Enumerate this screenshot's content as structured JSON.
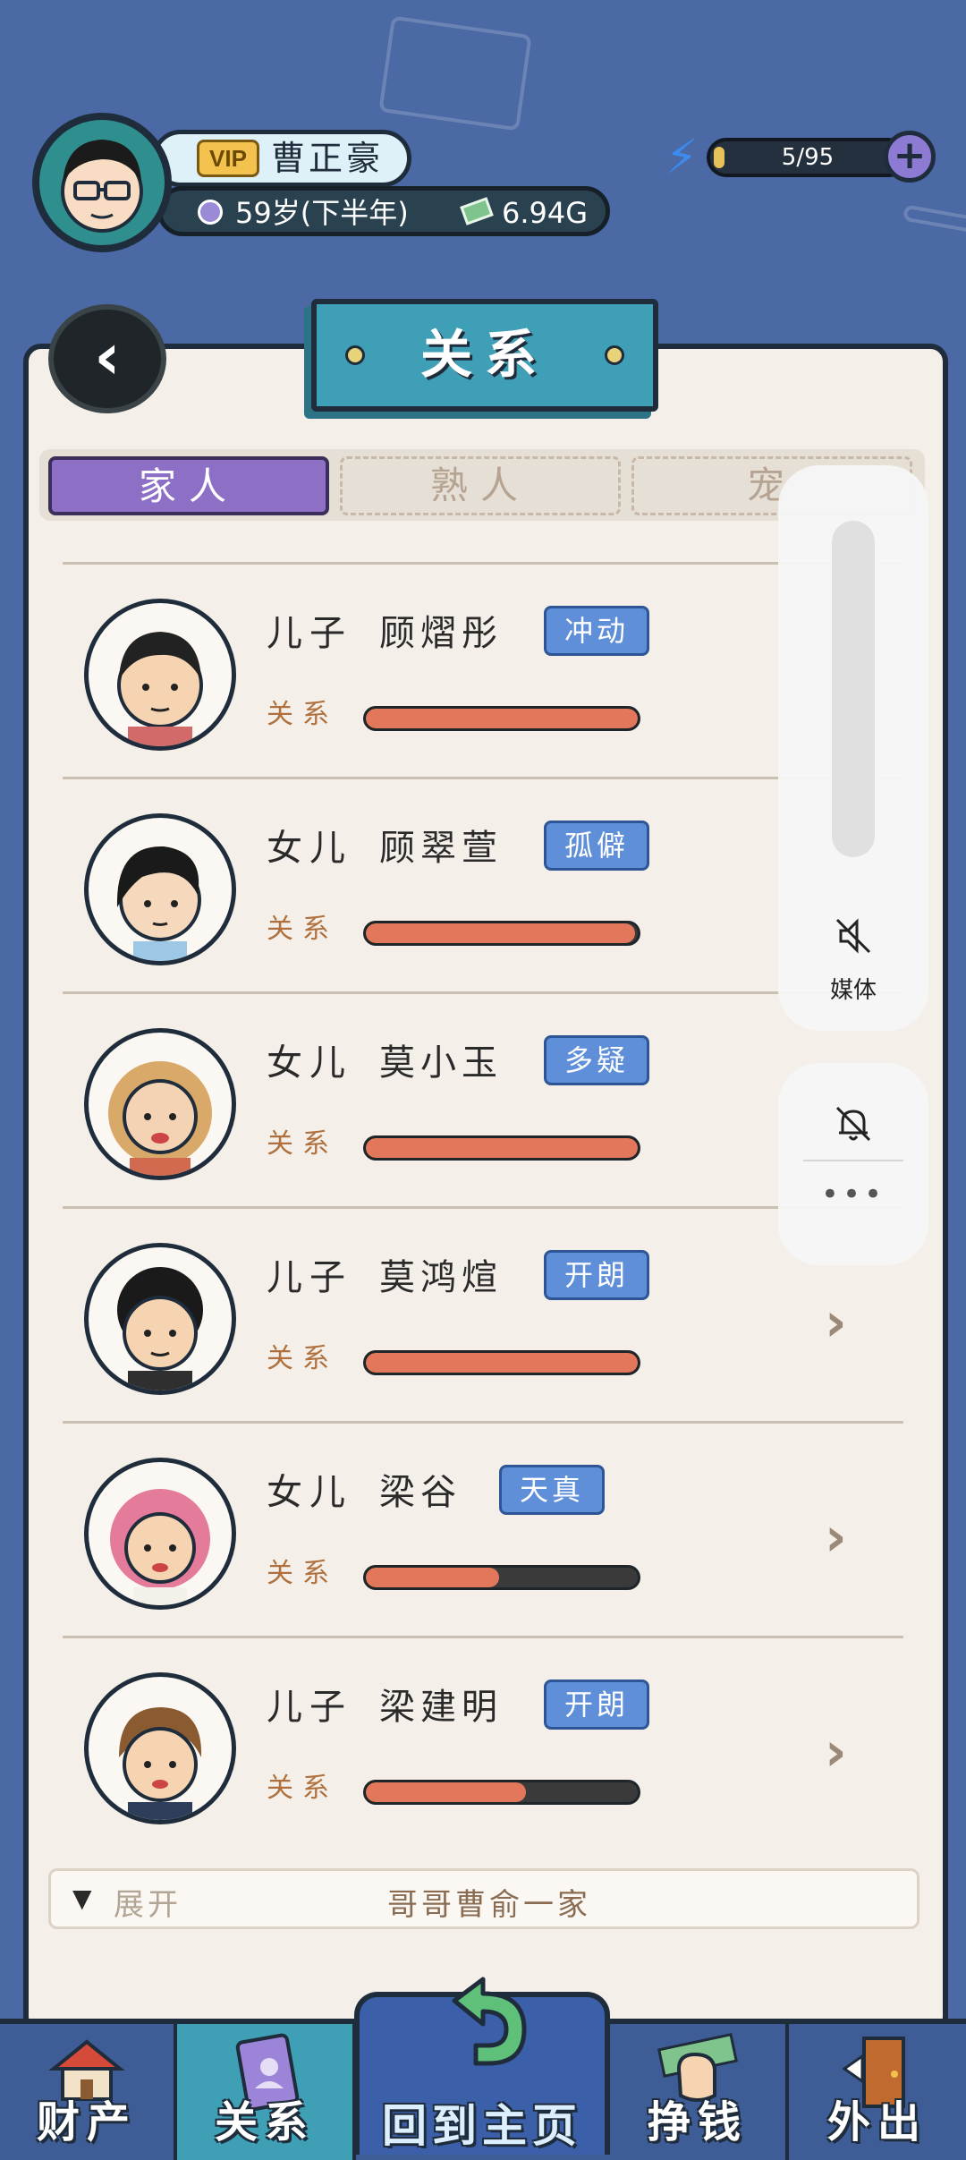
{
  "player": {
    "vip_label": "VIP",
    "name": "曹正豪",
    "age": "59岁(下半年)",
    "money": "6.94G"
  },
  "energy": {
    "current": 5,
    "max": 95,
    "text": "5/95"
  },
  "header": {
    "title": "关系"
  },
  "tabs": [
    {
      "label": "家人",
      "active": true
    },
    {
      "label": "熟人",
      "active": false
    },
    {
      "label": "宠",
      "active": false
    }
  ],
  "relations": [
    {
      "role": "儿子",
      "name": "顾熠彤",
      "trait": "冲动",
      "relation_label": "关系",
      "relation_value": 1.0
    },
    {
      "role": "女儿",
      "name": "顾翠萱",
      "trait": "孤僻",
      "relation_label": "关系",
      "relation_value": 0.99
    },
    {
      "role": "女儿",
      "name": "莫小玉",
      "trait": "多疑",
      "relation_label": "关系",
      "relation_value": 1.0
    },
    {
      "role": "儿子",
      "name": "莫鸿煊",
      "trait": "开朗",
      "relation_label": "关系",
      "relation_value": 1.0
    },
    {
      "role": "女儿",
      "name": "梁谷",
      "trait": "天真",
      "relation_label": "关系",
      "relation_value": 0.49
    },
    {
      "role": "儿子",
      "name": "梁建明",
      "trait": "开朗",
      "relation_label": "关系",
      "relation_value": 0.59
    }
  ],
  "expand": {
    "arrow": "▼",
    "label": "展开",
    "title": "哥哥曹俞一家"
  },
  "volume_overlay": {
    "media_label": "媒体"
  },
  "bottom_nav": {
    "assets": "财产",
    "relations": "关系",
    "home": "回到主页",
    "earn": "挣钱",
    "outing": "外出"
  },
  "colors": {
    "background": "#4b6aa5",
    "panel": "#f4efe9",
    "tab_active": "#8d70c6",
    "trait_badge": "#5f8fd8",
    "relation_fill": "#e2775b",
    "nav_active": "#3e9fb5"
  }
}
